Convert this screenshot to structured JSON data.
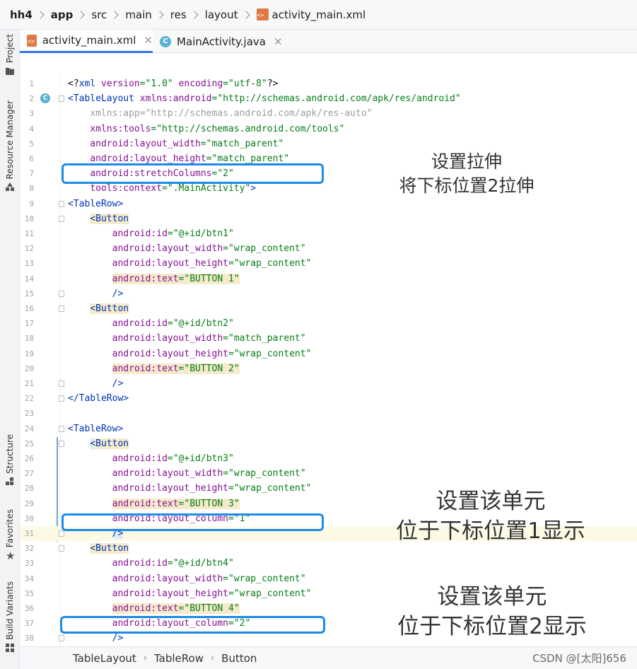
{
  "breadcrumb": {
    "items": [
      "hh4",
      "app",
      "src",
      "main",
      "res",
      "layout",
      "activity_main.xml"
    ]
  },
  "tool_windows": {
    "project": "Project",
    "resource_manager": "Resource Manager",
    "structure": "Structure",
    "favorites": "Favorites",
    "build_variants": "Build Variants"
  },
  "tabs": [
    {
      "label": "activity_main.xml",
      "icon": "xml-file-icon",
      "active": true
    },
    {
      "label": "MainActivity.java",
      "icon": "java-class-icon",
      "active": false
    }
  ],
  "editor": {
    "line_numbers": [
      "1",
      "2",
      "3",
      "4",
      "5",
      "6",
      "7",
      "8",
      "9",
      "10",
      "11",
      "12",
      "13",
      "14",
      "15",
      "16",
      "17",
      "18",
      "19",
      "20",
      "21",
      "22",
      "23",
      "24",
      "25",
      "26",
      "27",
      "28",
      "29",
      "30",
      "31",
      "32",
      "33",
      "34",
      "35",
      "36",
      "37",
      "38"
    ],
    "lines": [
      "<?xml version=\"1.0\" encoding=\"utf-8\"?>",
      "<TableLayout xmlns:android=\"http://schemas.android.com/apk/res/android\"",
      "    xmlns:app=\"http://schemas.android.com/apk/res-auto\"",
      "    xmlns:tools=\"http://schemas.android.com/tools\"",
      "    android:layout_width=\"match_parent\"",
      "    android:layout_height=\"match_parent\"",
      "    android:stretchColumns=\"2\"",
      "    tools:context=\".MainActivity\">",
      "<TableRow>",
      "    <Button",
      "        android:id=\"@+id/btn1\"",
      "        android:layout_width=\"wrap_content\"",
      "        android:layout_height=\"wrap_content\"",
      "        android:text=\"BUTTON 1\"",
      "        />",
      "    <Button",
      "        android:id=\"@+id/btn2\"",
      "        android:layout_width=\"match_parent\"",
      "        android:layout_height=\"wrap_content\"",
      "        android:text=\"BUTTON 2\"",
      "        />",
      "</TableRow>",
      "",
      "<TableRow>",
      "    <Button",
      "        android:id=\"@+id/btn3\"",
      "        android:layout_width=\"wrap_content\"",
      "        android:layout_height=\"wrap_content\"",
      "        android:text=\"BUTTON 3\"",
      "        android:layout_column=\"1\"",
      "        />",
      "    <Button",
      "        android:id=\"@+id/btn4\"",
      "        android:layout_width=\"wrap_content\"",
      "        android:layout_height=\"wrap_content\"",
      "        android:text=\"BUTTON 4\"",
      "        android:layout_column=\"2\"",
      "        />"
    ]
  },
  "annotations": [
    {
      "line1": "设置拉伸",
      "line2": "将下标位置2拉伸"
    },
    {
      "line1": "设置该单元",
      "line2": "位于下标位置1显示"
    },
    {
      "line1": "设置该单元",
      "line2": "位于下标位置2显示"
    }
  ],
  "bottom_breadcrumb": [
    "TableLayout",
    "TableRow",
    "Button"
  ],
  "watermark": "CSDN @[太阳]656",
  "colors": {
    "tag": "#0033b3",
    "attribute": "#871094",
    "value": "#067d17",
    "annotation_box": "#1c8ae8",
    "active_tab_underline": "#3574f0"
  }
}
